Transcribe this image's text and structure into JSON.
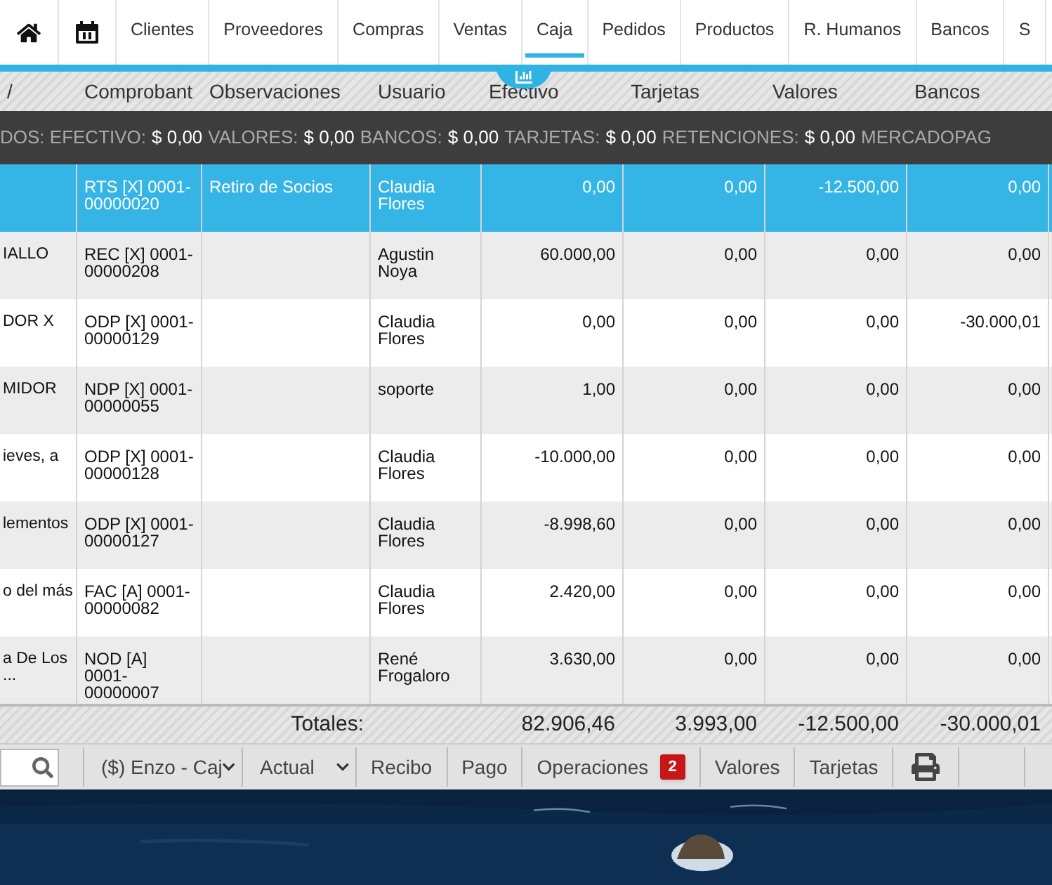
{
  "nav": {
    "tabs": [
      {
        "label": "Clientes",
        "selected": false
      },
      {
        "label": "Proveedores",
        "selected": false
      },
      {
        "label": "Compras",
        "selected": false
      },
      {
        "label": "Ventas",
        "selected": false
      },
      {
        "label": "Caja",
        "selected": true
      },
      {
        "label": "Pedidos",
        "selected": false
      },
      {
        "label": "Productos",
        "selected": false
      },
      {
        "label": "R. Humanos",
        "selected": false
      },
      {
        "label": "Bancos",
        "selected": false
      },
      {
        "label": "S",
        "selected": false
      }
    ]
  },
  "table": {
    "columns": [
      "/",
      "Comprobant",
      "Observaciones",
      "Usuario",
      "Efectivo",
      "Tarjetas",
      "Valores",
      "Bancos"
    ],
    "summary": [
      {
        "label": "DOS: EFECTIVO:",
        "value": "$ 0,00"
      },
      {
        "label": "VALORES:",
        "value": "$ 0,00"
      },
      {
        "label": "BANCOS:",
        "value": "$ 0,00"
      },
      {
        "label": "TARJETAS:",
        "value": "$ 0,00"
      },
      {
        "label": "RETENCIONES:",
        "value": "$ 0,00"
      },
      {
        "label": "MERCADOPAG"
      }
    ],
    "rows": [
      {
        "selected": true,
        "cells": [
          "",
          "RTS [X] 0001-00000020",
          "Retiro de Socios",
          "Claudia Flores",
          "0,00",
          "0,00",
          "-12.500,00",
          "0,00"
        ]
      },
      {
        "selected": false,
        "cells": [
          "IALLO",
          "REC [X] 0001-00000208",
          "",
          "Agustin Noya",
          "60.000,00",
          "0,00",
          "0,00",
          "0,00"
        ]
      },
      {
        "selected": false,
        "cells": [
          "DOR X",
          "ODP [X] 0001-00000129",
          "",
          "Claudia Flores",
          "0,00",
          "0,00",
          "0,00",
          "-30.000,01"
        ]
      },
      {
        "selected": false,
        "cells": [
          "MIDOR",
          "NDP [X] 0001-00000055",
          "",
          "soporte",
          "1,00",
          "0,00",
          "0,00",
          "0,00"
        ]
      },
      {
        "selected": false,
        "cells": [
          "ieves, a",
          "ODP [X] 0001-00000128",
          "",
          "Claudia Flores",
          "-10.000,00",
          "0,00",
          "0,00",
          "0,00"
        ]
      },
      {
        "selected": false,
        "cells": [
          "lementos",
          "ODP [X] 0001-00000127",
          "",
          "Claudia Flores",
          "-8.998,60",
          "0,00",
          "0,00",
          "0,00"
        ]
      },
      {
        "selected": false,
        "cells": [
          "o del más",
          "FAC [A] 0001-00000082",
          "",
          "Claudia Flores",
          "2.420,00",
          "0,00",
          "0,00",
          "0,00"
        ]
      },
      {
        "selected": false,
        "cells": [
          "a De Los ...",
          "NOD [A] 0001-00000007",
          "",
          "René Frogaloro",
          "3.630,00",
          "0,00",
          "0,00",
          "0,00"
        ]
      }
    ],
    "totals": {
      "label": "Totales:",
      "values": [
        "82.906,46",
        "3.993,00",
        "-12.500,00",
        "-30.000,01"
      ]
    }
  },
  "toolbar": {
    "selects": [
      "($) Enzo - Caj",
      "Actual"
    ],
    "buttons": [
      {
        "label": "Recibo"
      },
      {
        "label": "Pago"
      },
      {
        "label": "Operaciones",
        "badge": "2"
      },
      {
        "label": "Valores"
      },
      {
        "label": "Tarjetas"
      }
    ]
  }
}
